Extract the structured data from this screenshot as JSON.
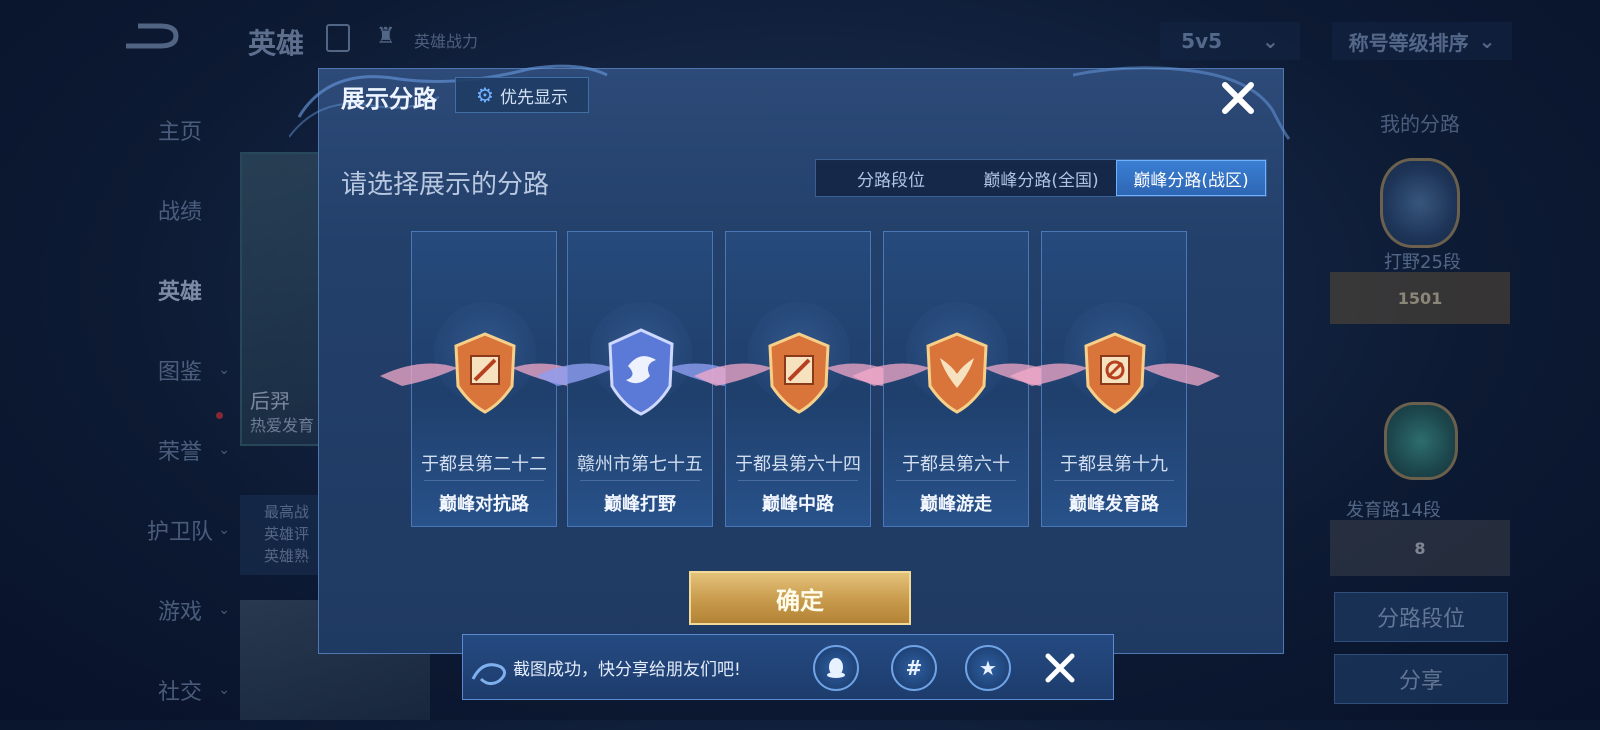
{
  "background": {
    "top_title": "英雄",
    "power_label": "英雄战力",
    "mode_select": "5v5",
    "sort_select": "称号等级排序",
    "side_nav": [
      {
        "label": "主页",
        "chevron": false,
        "active": false
      },
      {
        "label": "战绩",
        "chevron": false,
        "active": false
      },
      {
        "label": "英雄",
        "chevron": false,
        "active": true
      },
      {
        "label": "图鉴",
        "chevron": true,
        "active": false
      },
      {
        "label": "荣誉",
        "chevron": true,
        "active": false
      },
      {
        "label": "护卫队",
        "chevron": true,
        "active": false
      },
      {
        "label": "游戏",
        "chevron": true,
        "active": false
      },
      {
        "label": "社交",
        "chevron": true,
        "active": false
      }
    ],
    "hero_name": "后羿",
    "hero_sub": "热爱发育",
    "hero_info": [
      "最高战",
      "英雄评",
      "英雄熟"
    ],
    "my_routes_title": "我的分路",
    "rank1_label": "打野25段",
    "rank1_value": "1501",
    "rank2_label": "发育路14段",
    "rank2_value": "8",
    "route_rank_button": "分路段位",
    "share_button": "分享"
  },
  "modal": {
    "title": "展示分路",
    "priority_button": "优先显示",
    "subtitle": "请选择展示的分路",
    "tabs": [
      {
        "label": "分路段位",
        "active": false
      },
      {
        "label": "巅峰分路(全国)",
        "active": false
      },
      {
        "label": "巅峰分路(战区)",
        "active": true
      }
    ],
    "cards": [
      {
        "region": "于都县第二十二",
        "route": "巅峰对抗路",
        "badge": "orange",
        "emblem": "sword-icon"
      },
      {
        "region": "赣州市第七十五",
        "route": "巅峰打野",
        "badge": "blue",
        "emblem": "dragon-icon"
      },
      {
        "region": "于都县第六十四",
        "route": "巅峰中路",
        "badge": "orange",
        "emblem": "sword-icon"
      },
      {
        "region": "于都县第六十",
        "route": "巅峰游走",
        "badge": "orange",
        "emblem": "wings-icon"
      },
      {
        "region": "于都县第十九",
        "route": "巅峰发育路",
        "badge": "orange",
        "emblem": "target-icon"
      }
    ],
    "confirm_button": "确定"
  },
  "toast": {
    "text": "截图成功，快分享给朋友们吧!",
    "icons": [
      "qq-icon",
      "wechat-moments-icon",
      "qzone-icon"
    ]
  },
  "colors": {
    "accent": "#3a7fd3",
    "gold": "#c89a4c",
    "badge_orange": "#d9743a",
    "badge_blue": "#5b79d6"
  }
}
